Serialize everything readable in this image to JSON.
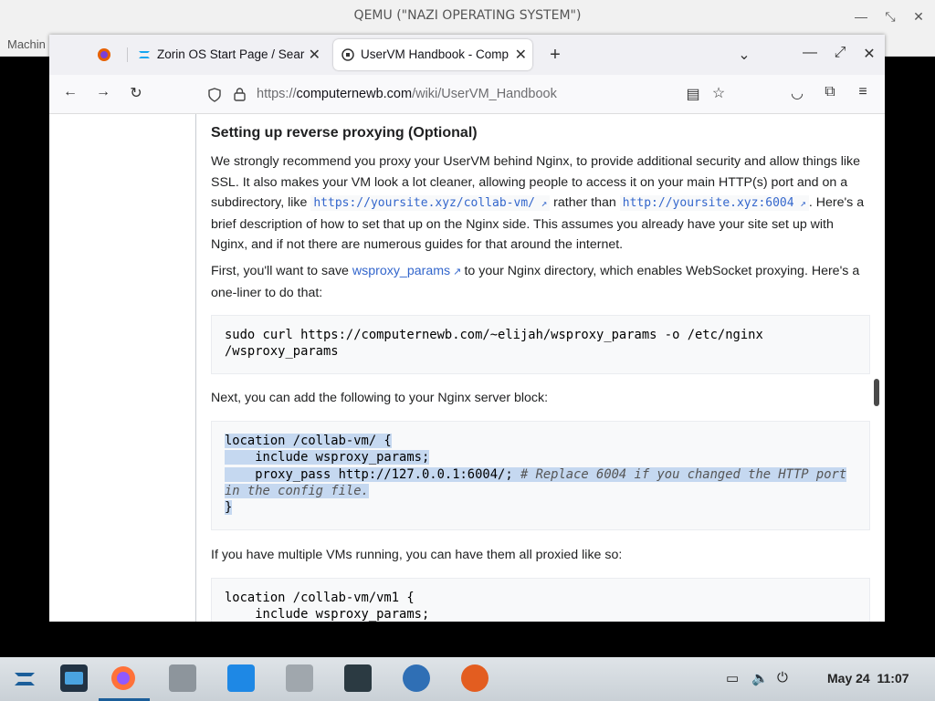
{
  "qemu": {
    "title": "QEMU (\"NAZI OPERATING SYSTEM\")",
    "menu_label": "Machin"
  },
  "tabs": [
    {
      "label": "Zorin OS Start Page / Sear"
    },
    {
      "label": "UserVM Handbook - Comp"
    }
  ],
  "url": {
    "prefix": "https://",
    "host": "computernewb.com",
    "path": "/wiki/UserVM_Handbook"
  },
  "article": {
    "heading": "Setting up reverse proxying (Optional)",
    "p1_a": "We strongly recommend you proxy your UserVM behind Nginx, to provide additional security and allow things like SSL. It also makes your VM look a lot cleaner, allowing people to access it on your main HTTP(s) port and on a subdirectory, like ",
    "p1_code1": "https://yoursite.xyz/collab-vm/",
    "p1_b": " rather than ",
    "p1_code2": "http://yoursite.xyz:6004",
    "p1_c": ". Here's a brief description of how to set that up on the Nginx side. This assumes you already have your site set up with Nginx, and if not there are numerous guides for that around the internet.",
    "p2_a": "First, you'll want to save ",
    "p2_link": "wsproxy_params",
    "p2_b": " to your Nginx directory, which enables WebSocket proxying. Here's a one-liner to do that:",
    "code1_line1": "sudo curl https://computernewb.com/~elijah/wsproxy_params -o /etc/nginx",
    "code1_line2": "/wsproxy_params",
    "p3": "Next, you can add the following to your Nginx server block:",
    "code2_line1": "location /collab-vm/ {",
    "code2_line2": "    include wsproxy_params;",
    "code2_line3a": "    proxy_pass http://127.0.0.1:6004/; ",
    "code2_line3b": "# Replace 6004 if you changed the HTTP port",
    "code2_line4": "in the config file.",
    "code2_line5": "}",
    "p4": "If you have multiple VMs running, you can have them all proxied like so:",
    "code3_line1": "location /collab-vm/vm1 {",
    "code3_line2": "    include wsproxy_params;"
  },
  "taskbar": {
    "date": "May 24",
    "time": "11:07"
  }
}
